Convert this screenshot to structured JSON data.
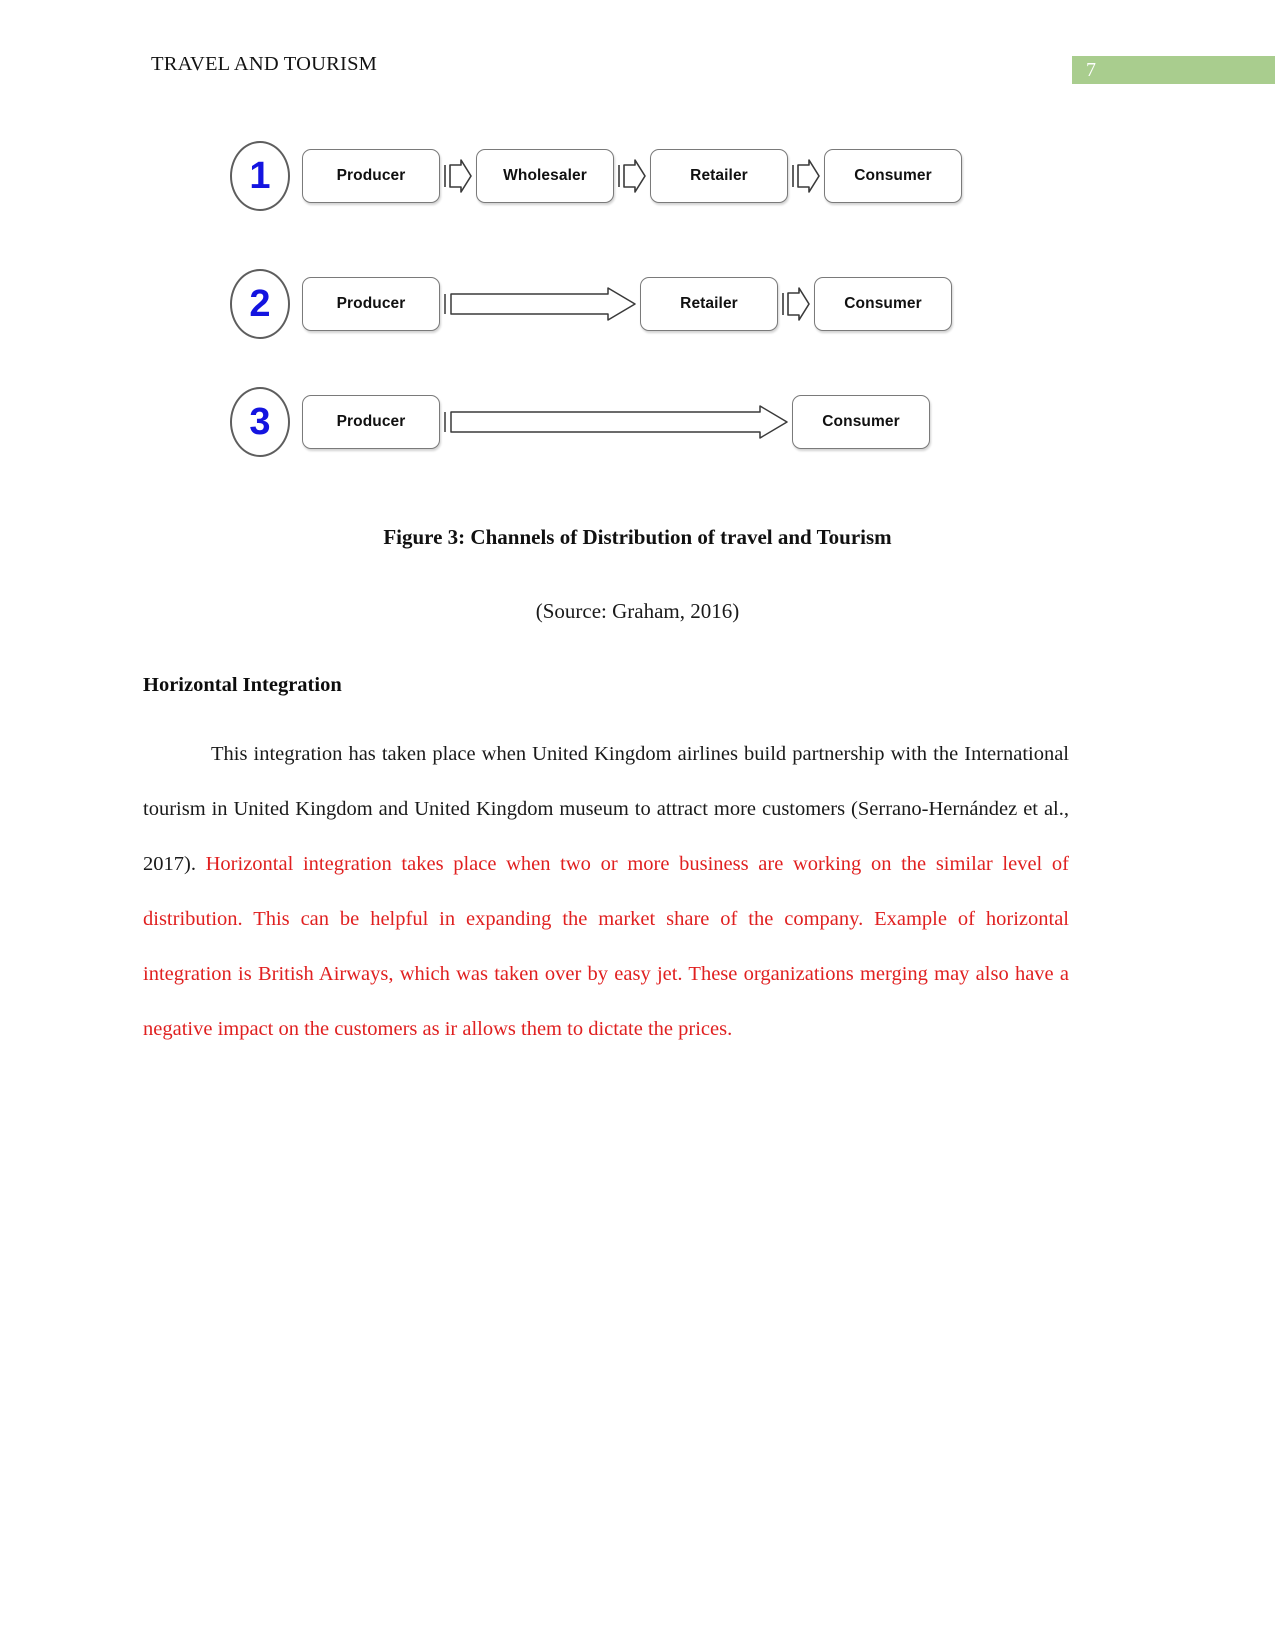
{
  "header": {
    "document_title": "TRAVEL AND TOURISM",
    "page_number": "7",
    "badge_color": "#a9cd8e"
  },
  "figure": {
    "caption": "Figure 3: Channels of Distribution of travel and Tourism",
    "source": "(Source: Graham, 2016)",
    "diagram": {
      "type": "flow-diagram",
      "accent_color": "#1414e0",
      "rows": [
        {
          "number": "1",
          "nodes": [
            "Producer",
            "Wholesaler",
            "Retailer",
            "Consumer"
          ],
          "connectors": [
            "chevron",
            "chevron",
            "chevron"
          ]
        },
        {
          "number": "2",
          "nodes": [
            "Producer",
            "Retailer",
            "Consumer"
          ],
          "connectors": [
            "long-arrow",
            "chevron"
          ]
        },
        {
          "number": "3",
          "nodes": [
            "Producer",
            "Consumer"
          ],
          "connectors": [
            "long-arrow"
          ]
        }
      ]
    }
  },
  "body": {
    "heading": "Horizontal Integration",
    "paragraph_black": "This integration has taken place when United Kingdom airlines build partnership with the International tourism in United Kingdom and United Kingdom museum to attract more customers (Serrano-Hernández et al., 2017).",
    "paragraph_red": "Horizontal integration takes place when two or more business are working on the similar level of distribution. This can be helpful in expanding the market share of the company. Example of horizontal integration is British Airways, which was taken over by easy jet. These organizations merging may also have a negative impact on the customers as ir allows them to dictate the prices.",
    "red_color": "#e02020"
  }
}
